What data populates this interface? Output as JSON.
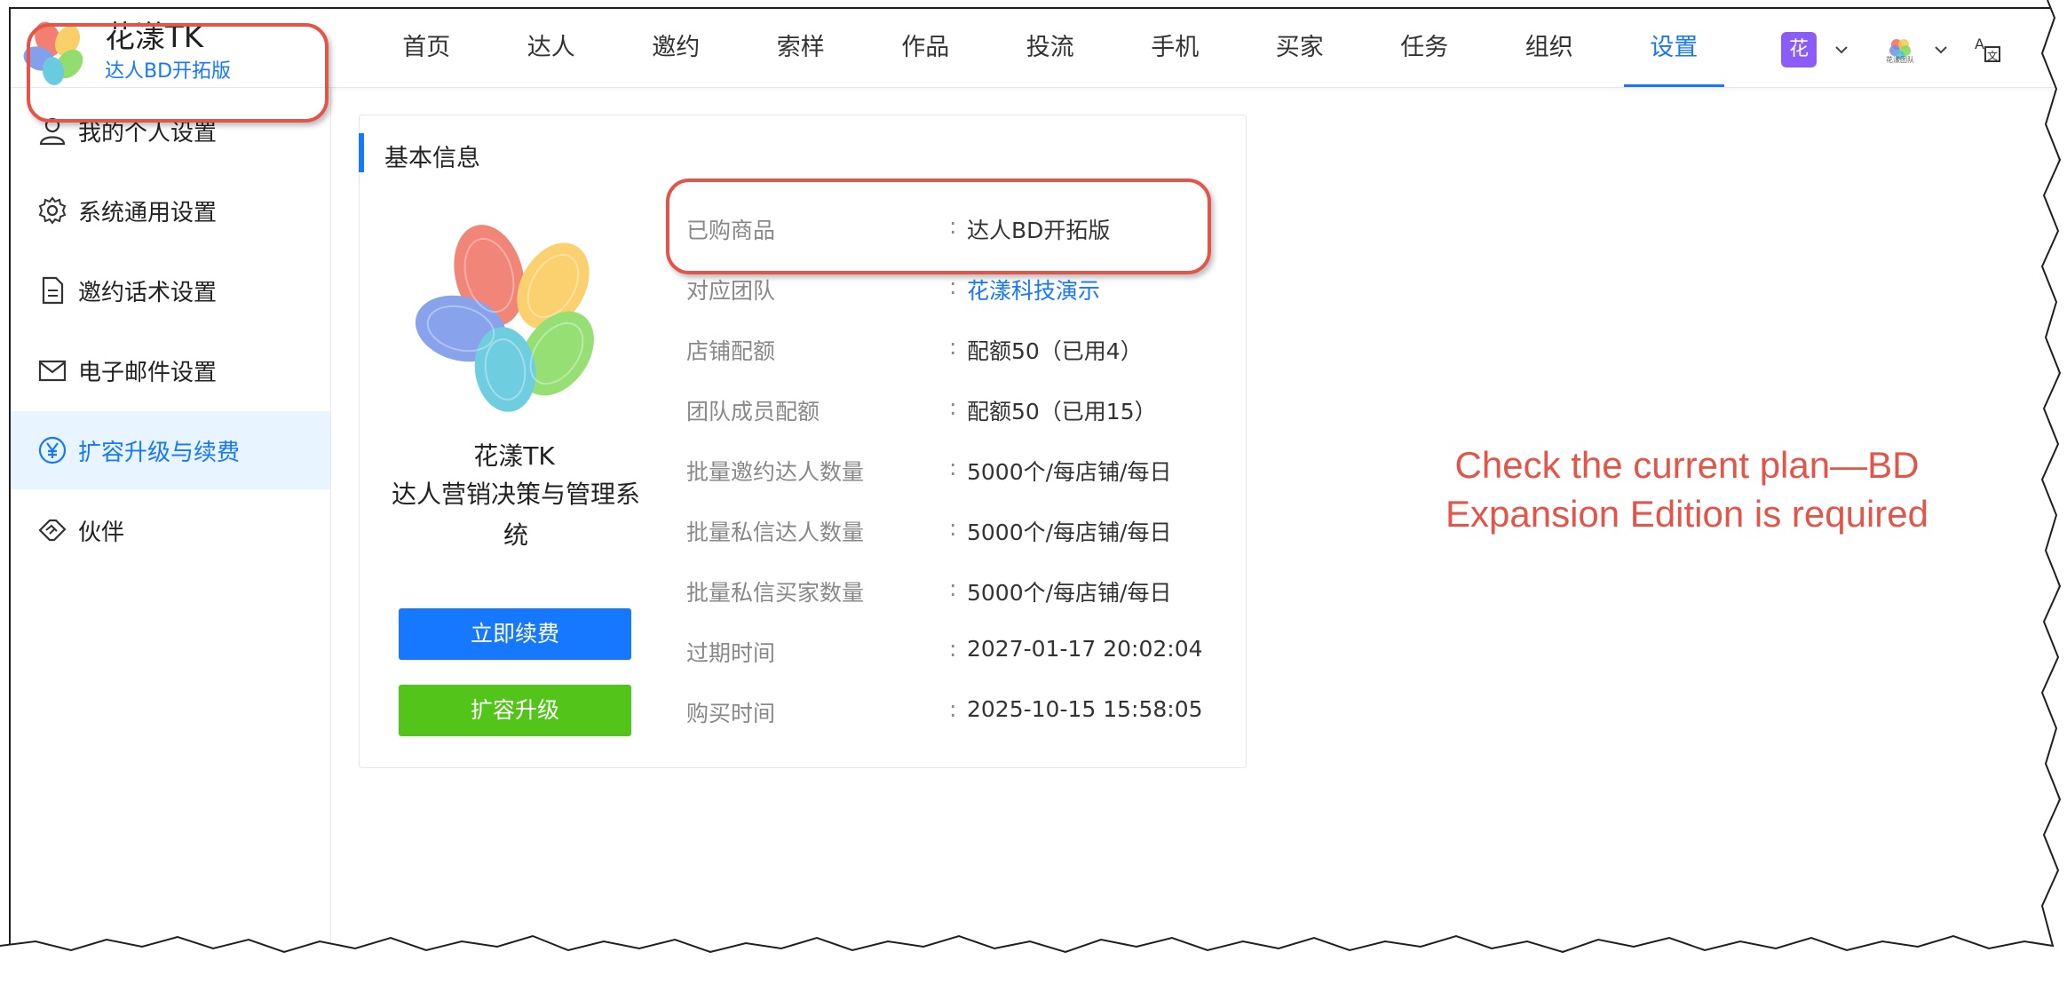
{
  "brand": {
    "name": "花漾TK",
    "plan": "达人BD开拓版"
  },
  "nav": {
    "items": [
      "首页",
      "达人",
      "邀约",
      "索样",
      "作品",
      "投流",
      "手机",
      "买家",
      "任务",
      "组织",
      "设置"
    ],
    "active_index": 10
  },
  "header_right": {
    "org_avatar": "花",
    "team_logo_text": "花漾团队",
    "language_icon": "translate-icon"
  },
  "sidebar": {
    "items": [
      {
        "label": "我的个人设置",
        "icon": "user-icon"
      },
      {
        "label": "系统通用设置",
        "icon": "gear-icon"
      },
      {
        "label": "邀约话术设置",
        "icon": "document-icon"
      },
      {
        "label": "电子邮件设置",
        "icon": "mail-icon"
      },
      {
        "label": "扩容升级与续费",
        "icon": "yen-circle-icon"
      },
      {
        "label": "伙伴",
        "icon": "handshake-icon"
      }
    ],
    "active_index": 4
  },
  "card": {
    "title": "基本信息",
    "product_name": "花漾TK",
    "product_desc": "达人营销决策与管理系统",
    "renew_label": "立即续费",
    "upgrade_label": "扩容升级",
    "rows": [
      {
        "key": "已购商品",
        "value": "达人BD开拓版"
      },
      {
        "key": "对应团队",
        "value": "花漾科技演示"
      },
      {
        "key": "店铺配额",
        "value": "配额50（已用4）"
      },
      {
        "key": "团队成员配额",
        "value": "配额50（已用15）"
      },
      {
        "key": "批量邀约达人数量",
        "value": "5000个/每店铺/每日"
      },
      {
        "key": "批量私信达人数量",
        "value": "5000个/每店铺/每日"
      },
      {
        "key": "批量私信买家数量",
        "value": "5000个/每店铺/每日"
      },
      {
        "key": "过期时间",
        "value": "2027-01-17 20:02:04"
      },
      {
        "key": "购买时间",
        "value": "2025-10-15 15:58:05"
      }
    ],
    "separator": ":"
  },
  "annotation": {
    "callout": "Check the current plan—BD Expansion Edition is required",
    "color": "#e25548"
  },
  "colors": {
    "accent": "#1677ff",
    "renew": "#1677ff",
    "upgrade": "#52c41a",
    "annotation": "#e25548"
  }
}
